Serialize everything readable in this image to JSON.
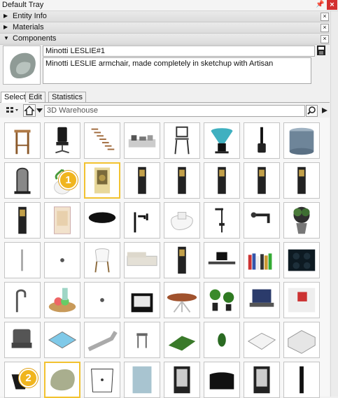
{
  "window": {
    "title": "Default Tray",
    "pin_glyph": "📌",
    "close_glyph": "×"
  },
  "panels": [
    {
      "label": "Entity Info",
      "expanded": false
    },
    {
      "label": "Materials",
      "expanded": false
    },
    {
      "label": "Components",
      "expanded": true
    }
  ],
  "panel_close_glyph": "×",
  "component": {
    "name": "Minotti LESLIE#1",
    "description": "Minotti LESLIE armchair, made completely in sketchup with Artisan"
  },
  "tabs": [
    {
      "label": "Select",
      "active": true
    },
    {
      "label": "Edit",
      "active": false
    },
    {
      "label": "Statistics",
      "active": false
    }
  ],
  "search": {
    "placeholder": "3D Warehouse"
  },
  "grid_items": [
    "bar-stool-thumbnail",
    "office-chair-thumbnail",
    "floating-stairs-thumbnail",
    "tray-set-thumbnail",
    "high-stool-thumbnail",
    "glass-lamp-thumbnail",
    "toilet-brush-thumbnail",
    "tank-thumbnail",
    "mirror-thumbnail",
    "plant-vase-thumbnail",
    "wine-cooler-thumbnail",
    "book-thumbnail",
    "book-thumbnail",
    "book-thumbnail",
    "book-thumbnail",
    "book-thumbnail",
    "book-thumbnail",
    "shower-cabin-thumbnail",
    "shower-head-thumbnail",
    "mixer-tap-thumbnail",
    "toilet-thumbnail",
    "shower-set-thumbnail",
    "wall-tap-thumbnail",
    "potted-plant-thumbnail",
    "door-handle-thumbnail",
    "small-object-thumbnail",
    "chair-thumbnail",
    "sofa-thumbnail",
    "book-thumbnail",
    "desk-thumbnail",
    "book-row-thumbnail",
    "cooktop-thumbnail",
    "faucet-thumbnail",
    "fruit-bowl-thumbnail",
    "small-object-thumbnail",
    "fire-pit-thumbnail",
    "dining-table-thumbnail",
    "plants-thumbnail",
    "laptop-thumbnail",
    "room-thumbnail",
    "lounge-chair-thumbnail",
    "pool-thumbnail",
    "sun-lounger-thumbnail",
    "stool-thumbnail",
    "hedge-thumbnail",
    "shrub-thumbnail",
    "bed-thumbnail",
    "room-isometric-thumbnail",
    "black-chair-thumbnail",
    "armchair-thumbnail",
    "basin-thumbnail",
    "glass-panel-thumbnail",
    "door-thumbnail",
    "curved-panel-thumbnail",
    "door-thumbnail",
    "panel-thumbnail"
  ],
  "selected_items": [
    10,
    49
  ],
  "badges": [
    {
      "text": "1"
    },
    {
      "text": "2"
    }
  ]
}
